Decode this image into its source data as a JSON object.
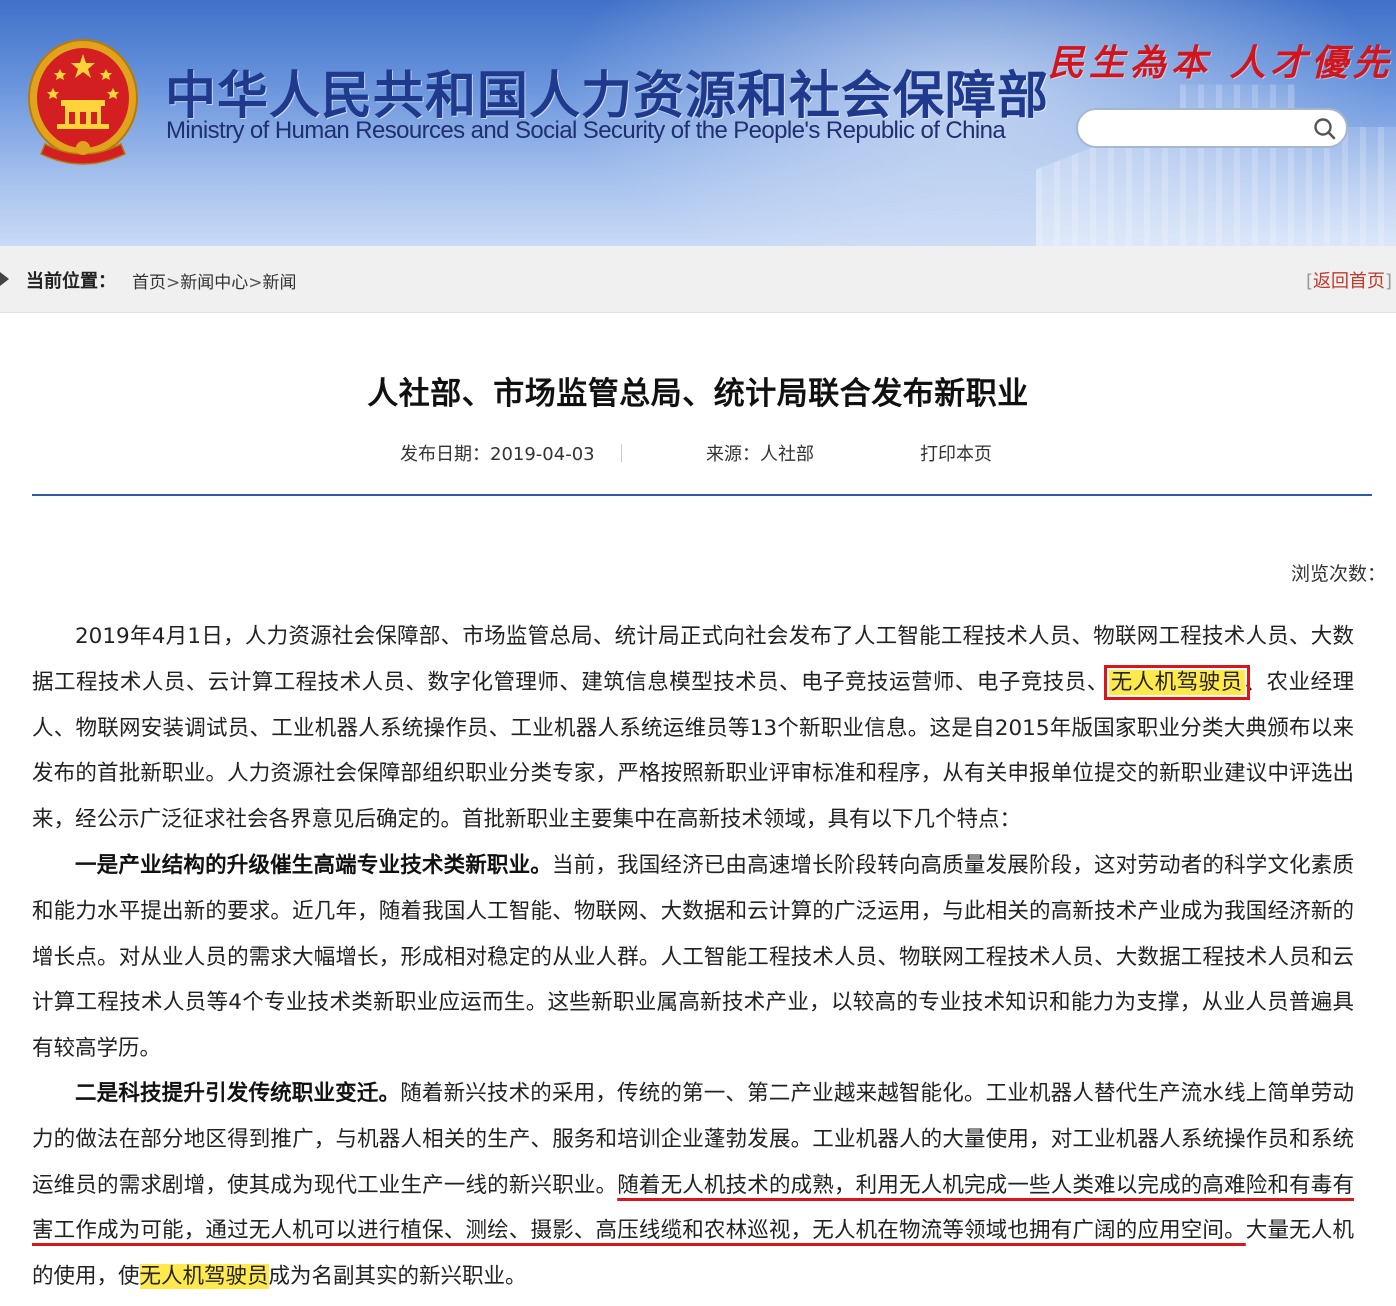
{
  "header": {
    "title_cn": "中华人民共和国人力资源和社会保障部",
    "title_en": "Ministry of Human Resources and Social Security of the People's Republic of China",
    "slogan": "民生為本 人才優先",
    "search": {
      "value": "",
      "placeholder": ""
    },
    "colors": {
      "banner": "#5a88d6",
      "title_cn": "#1f3a8c",
      "slogan": "#d4141b"
    }
  },
  "breadcrumb": {
    "label": "当前位置：",
    "items": [
      "首页",
      "新闻中心",
      "新闻"
    ],
    "separator": ">",
    "back_home": "返回首页"
  },
  "article": {
    "title": "人社部、市场监管总局、统计局联合发布新职业",
    "date_label": "发布日期：",
    "date": "2019-04-03",
    "source_label": "来源：",
    "source": "人社部",
    "print_label": "打印本页",
    "views_label": "浏览次数：",
    "p1": {
      "a": "2019年4月1日，人力资源社会保障部、市场监管总局、统计局正式向社会发布了人工智能工程技术人员、物联网工程技术人员、大数据工程技术人员、云计算工程技术人员、数字化管理师、建筑信息模型技术员、电子竞技运营师、电子竞技员、",
      "highlight": "无人机驾驶员",
      "b": "、农业经理人、物联网安装调试员、工业机器人系统操作员、工业机器人系统运维员等13个新职业信息。这是自2015年版国家职业分类大典颁布以来发布的首批新职业。人力资源社会保障部组织职业分类专家，严格按照新职业评审标准和程序，从有关申报单位提交的新职业建议中评选出来，经公示广泛征求社会各界意见后确定的。首批新职业主要集中在高新技术领域，具有以下几个特点："
    },
    "p2": {
      "lead": "一是产业结构的升级催生高端专业技术类新职业。",
      "body": "当前，我国经济已由高速增长阶段转向高质量发展阶段，这对劳动者的科学文化素质和能力水平提出新的要求。近几年，随着我国人工智能、物联网、大数据和云计算的广泛运用，与此相关的高新技术产业成为我国经济新的增长点。对从业人员的需求大幅增长，形成相对稳定的从业人群。人工智能工程技术人员、物联网工程技术人员、大数据工程技术人员和云计算工程技术人员等4个专业技术类新职业应运而生。这些新职业属高新技术产业，以较高的专业技术知识和能力为支撑，从业人员普遍具有较高学历。"
    },
    "p3": {
      "lead": "二是科技提升引发传统职业变迁。",
      "a": "随着新兴技术的采用，传统的第一、第二产业越来越智能化。工业机器人替代生产流水线上简单劳动力的做法在部分地区得到推广，与机器人相关的生产、服务和培训企业蓬勃发展。工业机器人的大量使用，对工业机器人系统操作员和系统运维员的需求剧增，使其成为现代工业生产一线的新兴职业。",
      "underlined": "随着无人机技术的成熟，利用无人机完成一些人类难以完成的高难险和有毒有害工作成为可能，通过无人机可以进行植保、测绘、摄影、高压线缆和农林巡视，无人机在物流等领域也拥有广阔的应用空间。",
      "b": "大量无人机的使用，使",
      "highlight": "无人机驾驶员",
      "c": "成为名副其实的新兴职业。"
    },
    "colors": {
      "highlight": "#ffe94d",
      "annotation_red": "#d8161c",
      "rule": "#2f5aa6"
    }
  }
}
